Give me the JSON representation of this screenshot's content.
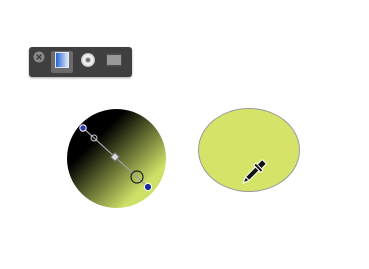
{
  "toolbar": {
    "close_icon": "close-x-icon",
    "tools": [
      {
        "name": "linear-gradient-tool",
        "icon": "linear-gradient-icon",
        "active": true
      },
      {
        "name": "radial-gradient-tool",
        "icon": "radial-gradient-icon",
        "active": false
      },
      {
        "name": "pattern-tool",
        "icon": "pattern-icon",
        "active": false
      }
    ],
    "colors": {
      "background": "#3f3f3f",
      "active_button": "#6b6b6b"
    }
  },
  "shapes": {
    "gradient_circle": {
      "fill_start": "#000000",
      "fill_end": "#cfe067",
      "handle_start_color": "#2b3bb0",
      "handle_end_color": "#1a2a9c"
    },
    "solid_circle": {
      "fill": "#d5e368",
      "stroke": "#9a9a9a"
    }
  },
  "cursor": {
    "icon": "eyedropper-icon"
  }
}
